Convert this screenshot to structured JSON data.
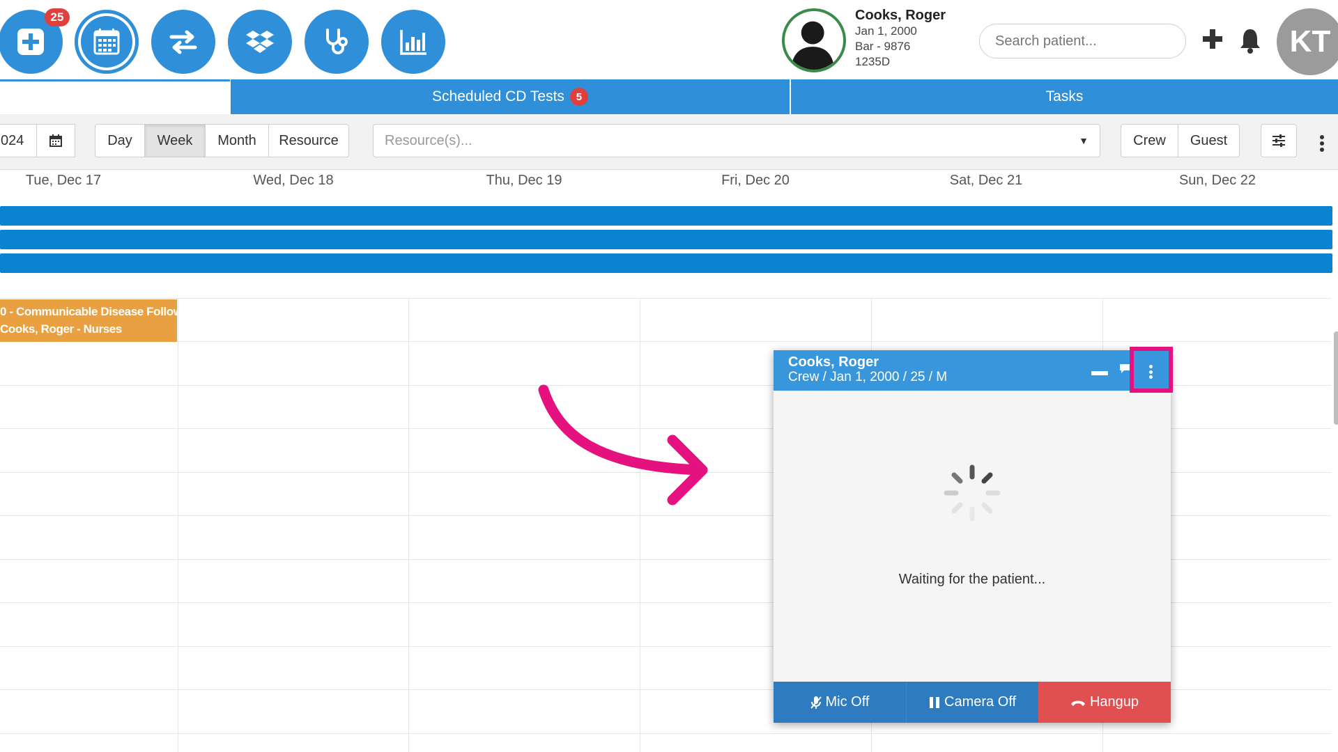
{
  "header": {
    "app_icons": [
      {
        "name": "add-patient-icon",
        "badge": "25"
      },
      {
        "name": "calendar-icon"
      },
      {
        "name": "transfer-icon"
      },
      {
        "name": "dropbox-icon"
      },
      {
        "name": "stethoscope-icon"
      },
      {
        "name": "bar-chart-icon"
      }
    ],
    "patient": {
      "name": "Cooks, Roger",
      "dob": "Jan 1, 2000",
      "bar": "Bar - 9876",
      "code": "1235D"
    },
    "search_placeholder": "Search patient...",
    "avatar_initials": "KT"
  },
  "tabs": [
    {
      "label": "Scheduled CD Tests",
      "badge": "5"
    },
    {
      "label": "Tasks"
    }
  ],
  "toolbar": {
    "date_partial": "024",
    "view_buttons": [
      "Day",
      "Week",
      "Month",
      "Resource"
    ],
    "active_view": "Week",
    "resource_placeholder": "Resource(s)...",
    "filter_buttons": [
      "Crew",
      "Guest"
    ]
  },
  "calendar": {
    "days": [
      "Tue, Dec 17",
      "Wed, Dec 18",
      "Thu, Dec 19",
      "Fri, Dec 20",
      "Sat, Dec 21",
      "Sun, Dec 22"
    ],
    "event": {
      "line1": "0 - Communicable Disease Follow",
      "line2": "Cooks, Roger - Nurses"
    }
  },
  "video_popup": {
    "title": "Cooks, Roger",
    "subtitle": "Crew / Jan 1, 2000 / 25 / M",
    "status": "Waiting for the patient...",
    "mic_label": "Mic Off",
    "camera_label": "Camera Off",
    "hangup_label": "Hangup"
  },
  "colors": {
    "primary": "#2f8fd8",
    "allday_bar": "#0a84d0",
    "event": "#e8a040",
    "badge": "#e0403c",
    "highlight": "#e4117f",
    "hangup": "#e05050",
    "control": "#2e7bbf"
  }
}
